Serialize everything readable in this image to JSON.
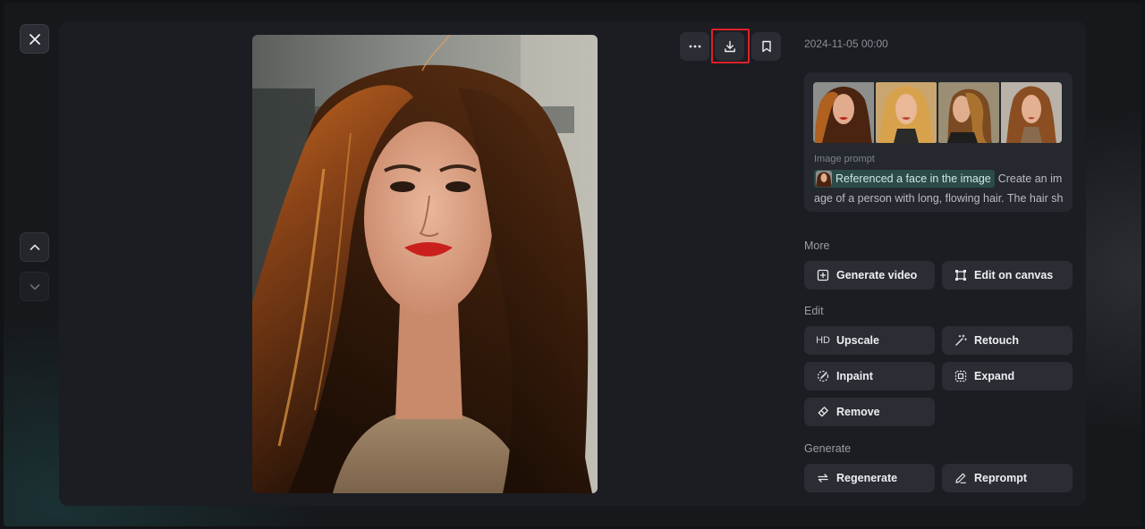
{
  "timestamp": "2024-11-05 00:00",
  "prompt": {
    "label": "Image prompt",
    "chip": "Referenced a face in the image",
    "text": "Create an image of a person with long, flowing hair. The hair sho"
  },
  "sections": {
    "more": "More",
    "edit": "Edit",
    "generate": "Generate"
  },
  "actions": {
    "generate_video": "Generate video",
    "edit_on_canvas": "Edit on canvas",
    "upscale_badge": "HD",
    "upscale": "Upscale",
    "retouch": "Retouch",
    "inpaint": "Inpaint",
    "expand": "Expand",
    "remove": "Remove",
    "regenerate": "Regenerate",
    "reprompt": "Reprompt"
  },
  "icons": {
    "close": "close-icon",
    "up": "chevron-up-icon",
    "down": "chevron-down-icon",
    "more": "more-horizontal-icon",
    "download": "download-icon",
    "bookmark": "bookmark-icon"
  },
  "colors": {
    "highlight": "#e0202a",
    "chip_bg": "#2c4a4a"
  }
}
